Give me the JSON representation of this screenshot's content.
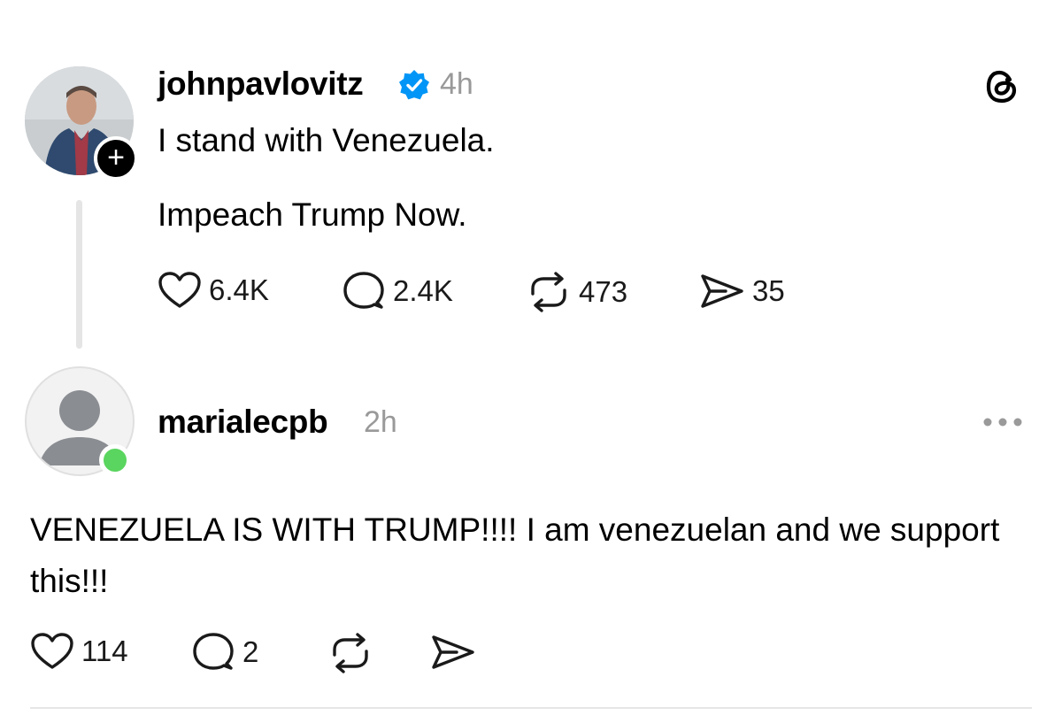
{
  "posts": [
    {
      "username": "johnpavlovitz",
      "verified": true,
      "time": "4h",
      "lines": [
        "I stand with Venezuela.",
        "Impeach Trump Now."
      ],
      "likes": "6.4K",
      "replies": "2.4K",
      "reposts": "473",
      "shares": "35",
      "follow_badge": "+"
    },
    {
      "username": "marialecpb",
      "time": "2h",
      "text": "VENEZUELA IS WITH TRUMP!!!! I am venezuelan and we support this!!!",
      "likes": "114",
      "replies": "2",
      "online": true
    }
  ],
  "icons": {
    "app_logo": "threads-logo-icon",
    "like": "heart-icon",
    "reply": "speech-bubble-icon",
    "repost": "repost-icon",
    "share": "paper-plane-icon",
    "more": "more-horizontal-icon",
    "verified": "verified-badge-icon"
  },
  "colors": {
    "verified": "#0095f6",
    "online": "#5ad55f",
    "muted_text": "#999999",
    "thread_line": "#e5e5e5"
  }
}
